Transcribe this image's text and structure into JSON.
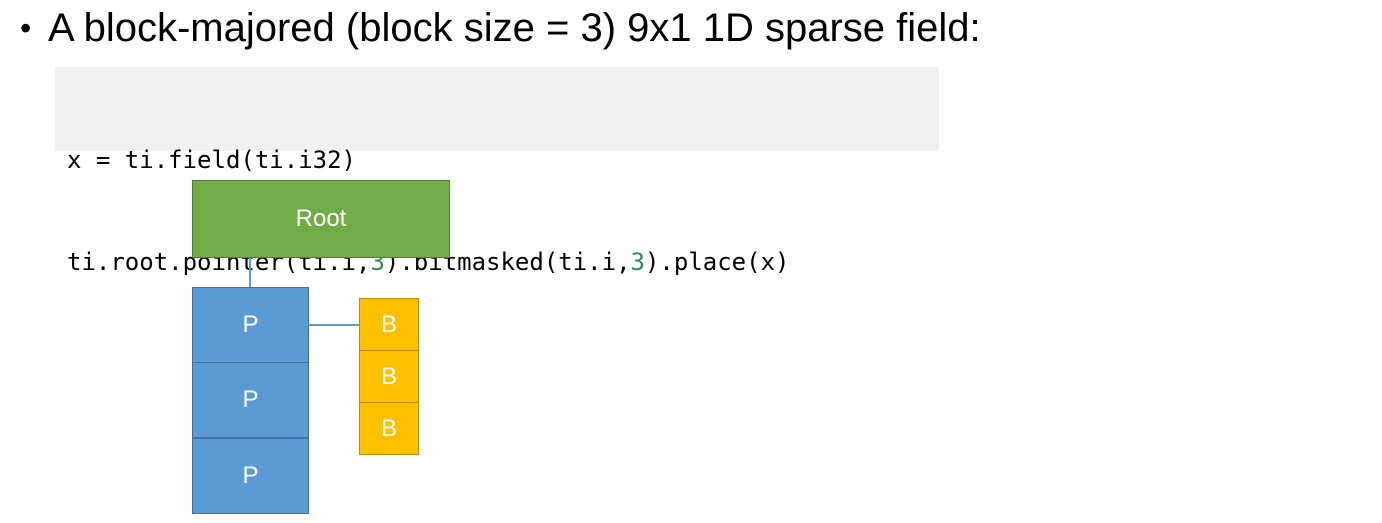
{
  "slide": {
    "bullet_glyph": "•",
    "bullet_text": "A block-majored (block size = 3) 9x1 1D sparse field:"
  },
  "code": {
    "line1": "x = ti.field(ti.i32)",
    "line2_a": "ti.root.pointer(ti.i,",
    "line2_num1": "3",
    "line2_b": ").bitmasked(ti.i,",
    "line2_num2": "3",
    "line2_c": ").place(x)",
    "number_color": "#2d8f57"
  },
  "diagram": {
    "root_label": "Root",
    "pointer_labels": [
      "P",
      "P",
      "P"
    ],
    "bitmask_labels": [
      "B",
      "B",
      "B"
    ],
    "colors": {
      "root": "#70ad47",
      "pointer": "#5b9bd5",
      "bitmask": "#ffc000"
    }
  }
}
